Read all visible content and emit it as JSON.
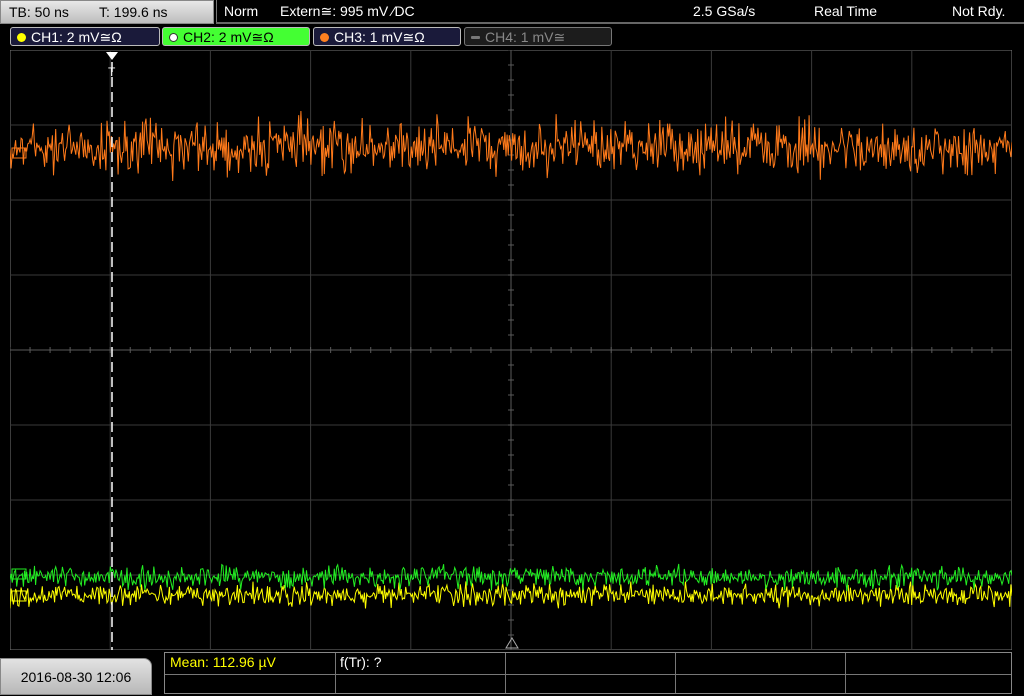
{
  "header": {
    "timebase": "TB: 50 ns",
    "trigger_time": "T: 199.6 ns",
    "trigger_mode": "Norm",
    "trigger_source": "Extern≅: 995 mV ⁄DC",
    "sample_rate": "2.5 GSa/s",
    "acquisition_mode": "Real Time",
    "status": "Not Rdy."
  },
  "channels": [
    {
      "label": "CH1: 2 mV≅Ω",
      "color": "#ffff00",
      "active": false
    },
    {
      "label": "CH2: 2 mV≅Ω",
      "color": "#44ff33",
      "active": true
    },
    {
      "label": "CH3: 1 mV≅Ω",
      "color": "#ff8020",
      "active": false
    },
    {
      "label": "CH4: 1 mV≅",
      "color": "#777777",
      "active": false
    }
  ],
  "footer": {
    "datetime": "2016-08-30 12:06",
    "mean": "Mean: 112.96 µV",
    "freq": "f(Tr): ?"
  },
  "colors": {
    "grid": "#3a3a3a",
    "grid_center": "#5a5a5a",
    "ch1": "#ffff00",
    "ch2": "#22ee22",
    "ch3": "#ff7a1a",
    "trigger_marker": "#ffffff"
  },
  "waveforms": {
    "ch3_noise_mv": 0.5,
    "ch2_noise_mv": 1.0,
    "ch1_noise_mv": 1.0
  }
}
